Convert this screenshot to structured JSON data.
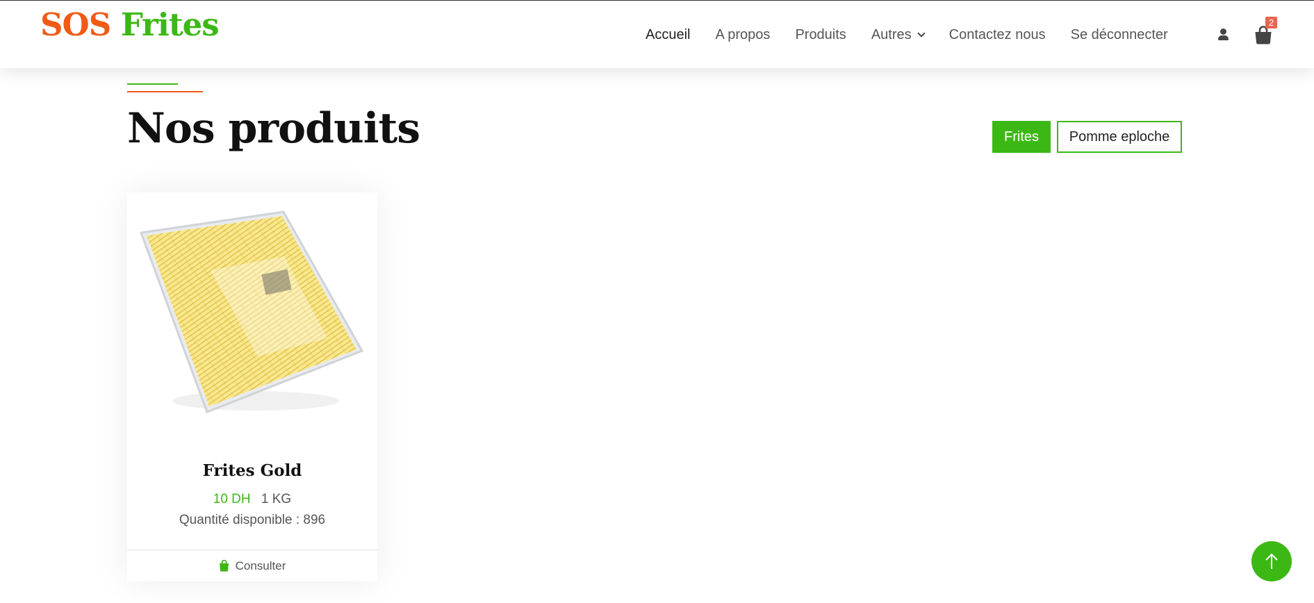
{
  "brand": {
    "part1": "SOS",
    "part2": "Frites",
    "color_primary": "#f05a16",
    "color_secondary": "#3cb815"
  },
  "nav": {
    "items": [
      {
        "label": "Accueil",
        "active": true
      },
      {
        "label": "A propos"
      },
      {
        "label": "Produits"
      },
      {
        "label": "Autres",
        "dropdown": true
      },
      {
        "label": "Contactez nous"
      },
      {
        "label": "Se déconnecter"
      }
    ],
    "user_icon": "user-icon",
    "cart_icon": "shopping-bag-icon",
    "cart_count": "2"
  },
  "section": {
    "title": "Nos produits"
  },
  "filters": [
    {
      "label": "Frites",
      "active": true
    },
    {
      "label": "Pomme eploche",
      "active": false
    }
  ],
  "products": [
    {
      "name": "Frites Gold",
      "price": "10 DH",
      "weight": "1 KG",
      "quantity": "Quantité disponible : 896",
      "action_label": "Consulter",
      "action_icon": "shopping-bag-icon",
      "image": "bag of frozen french fries"
    }
  ],
  "back_to_top_icon": "arrow-up-icon"
}
